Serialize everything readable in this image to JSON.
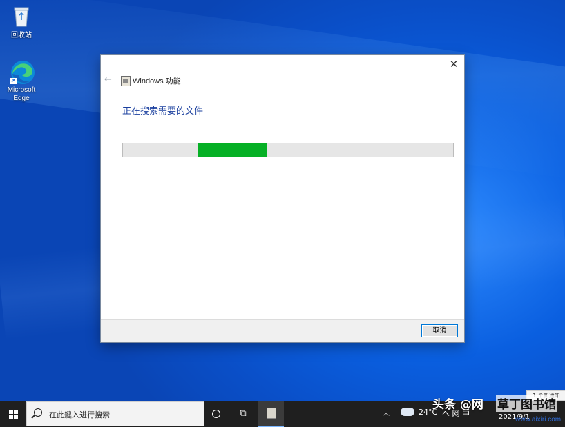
{
  "desktop": {
    "icons": [
      {
        "label": "回收站",
        "icon": "recycle-bin-icon"
      },
      {
        "label": "Microsoft Edge",
        "icon": "edge-icon"
      }
    ]
  },
  "dialog": {
    "title": "Windows 功能",
    "close_glyph": "✕",
    "back_glyph": "←",
    "heading": "正在搜索需要的文件",
    "progress_fraction": 0.21,
    "cancel_label": "取消",
    "accent": "#06b025"
  },
  "taskbar": {
    "search_placeholder": "在此鍵入进行搜索",
    "temperature": "24°C",
    "tray_text": "へ 网 中",
    "date": "2021/9/1",
    "notification_text": "1 个新通知"
  },
  "watermark": {
    "left": "头条 @网",
    "right": "草丁图书馆",
    "url": "www.aixiri.com"
  }
}
